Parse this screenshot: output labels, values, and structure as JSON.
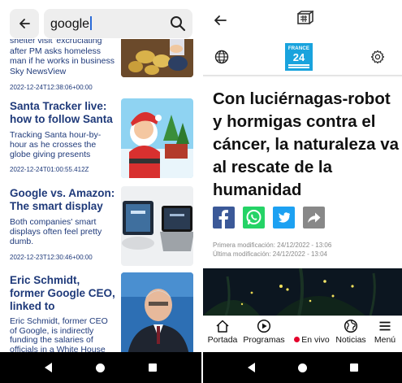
{
  "left": {
    "search": {
      "query": "google"
    },
    "items": [
      {
        "title": "",
        "desc": "shelter visit 'excruciating' after PM asks homeless man if he works in business Sky NewsView",
        "date": "2022-12-24T12:38:06+00:00"
      },
      {
        "title": "Santa Tracker live: how to follow Santa",
        "desc": "Tracking Santa hour-by-hour as he crosses the globe giving presents",
        "date": "2022-12-24T01:00:55.412Z"
      },
      {
        "title": "Google vs. Amazon: The smart display",
        "desc": "Both companies' smart displays often feel pretty dumb.",
        "date": "2022-12-23T12:30:46+00:00"
      },
      {
        "title": "Eric Schmidt, former Google CEO, linked to",
        "desc": "Eric Schmidt, former CEO of Google, is indirectly funding the salaries of officials in a White House office tasked with advising President",
        "date": ""
      }
    ]
  },
  "right": {
    "logo": {
      "line1": "FRANCE",
      "line2": "24"
    },
    "headline": "Con luciérnagas-robot y hormigas contra el cáncer, la naturaleza va al rescate de la humanidad",
    "meta": {
      "first_modified": "Primera modificación: 24/12/2022 - 13:06",
      "last_modified": "Última modificación: 24/12/2022 - 13:04"
    },
    "tabs": {
      "home": "Portada",
      "programs": "Programas",
      "live": "En vivo",
      "news": "Noticias",
      "menu": "Menú"
    },
    "colors": {
      "facebook": "#3b5998",
      "whatsapp": "#25d366",
      "twitter": "#1da1f2",
      "share": "#888888",
      "brand": "#19a3dd",
      "live": "#e4002b"
    }
  }
}
